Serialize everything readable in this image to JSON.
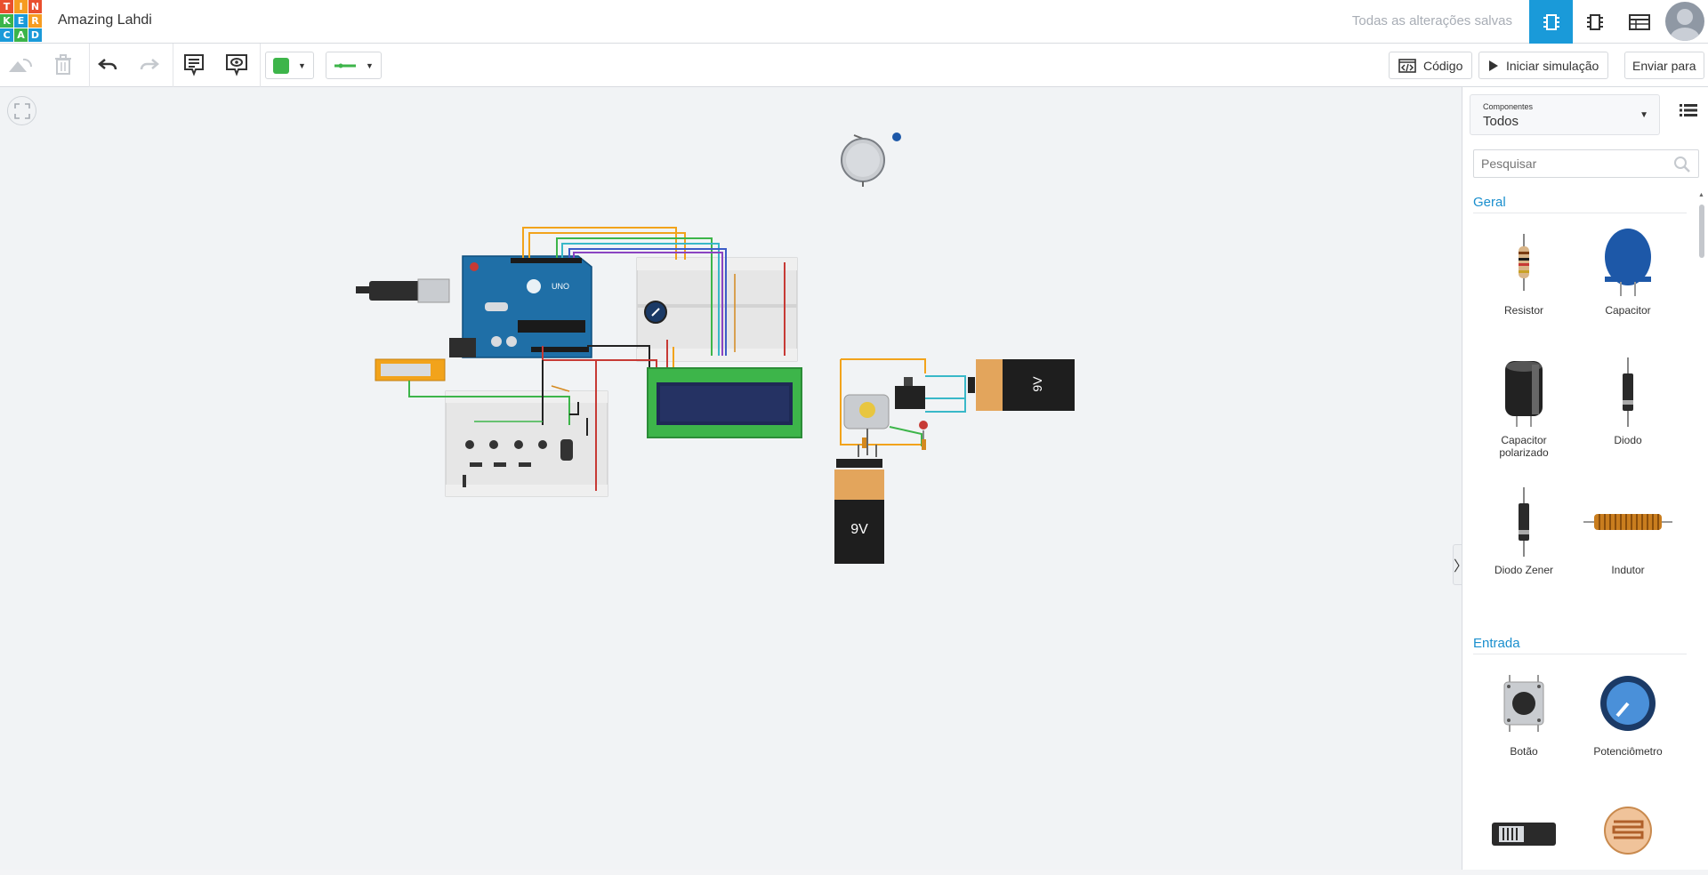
{
  "app": {
    "logo_letters": [
      "T",
      "I",
      "N",
      "K",
      "E",
      "R",
      "C",
      "A",
      "D"
    ],
    "logo_colors": [
      "#e94f2e",
      "#f69c21",
      "#e94f2e",
      "#3bb44a",
      "#1a9ad9",
      "#f69c21",
      "#1a9ad9",
      "#3bb44a",
      "#1a9ad9"
    ],
    "project_title": "Amazing Lahdi",
    "save_status": "Todas as alterações salvas",
    "accent_color": "#1a9ad9"
  },
  "toolbar": {
    "code_label": "Código",
    "simulate_label": "Iniciar simulação",
    "send_label": "Enviar para",
    "fill_color": "#3db54a",
    "wire_color": "#3db54a"
  },
  "canvas": {
    "arduino_label": "UNO",
    "battery_label": "9V"
  },
  "panel": {
    "components_small": "Componentes",
    "components_value": "Todos",
    "search_placeholder": "Pesquisar",
    "sections": [
      {
        "title": "Geral",
        "items": [
          {
            "label": "Resistor",
            "icon": "resistor-icon"
          },
          {
            "label": "Capacitor",
            "icon": "capacitor-icon"
          },
          {
            "label": "Capacitor polarizado",
            "icon": "polarized-capacitor-icon"
          },
          {
            "label": "Diodo",
            "icon": "diode-icon"
          },
          {
            "label": "Diodo Zener",
            "icon": "zener-diode-icon"
          },
          {
            "label": "Indutor",
            "icon": "inductor-icon"
          }
        ]
      },
      {
        "title": "Entrada",
        "items": [
          {
            "label": "Botão",
            "icon": "pushbutton-icon"
          },
          {
            "label": "Potenciômetro",
            "icon": "potentiometer-icon"
          },
          {
            "label": "",
            "icon": "slide-switch-icon"
          },
          {
            "label": "",
            "icon": "photoresistor-icon"
          }
        ]
      }
    ]
  }
}
